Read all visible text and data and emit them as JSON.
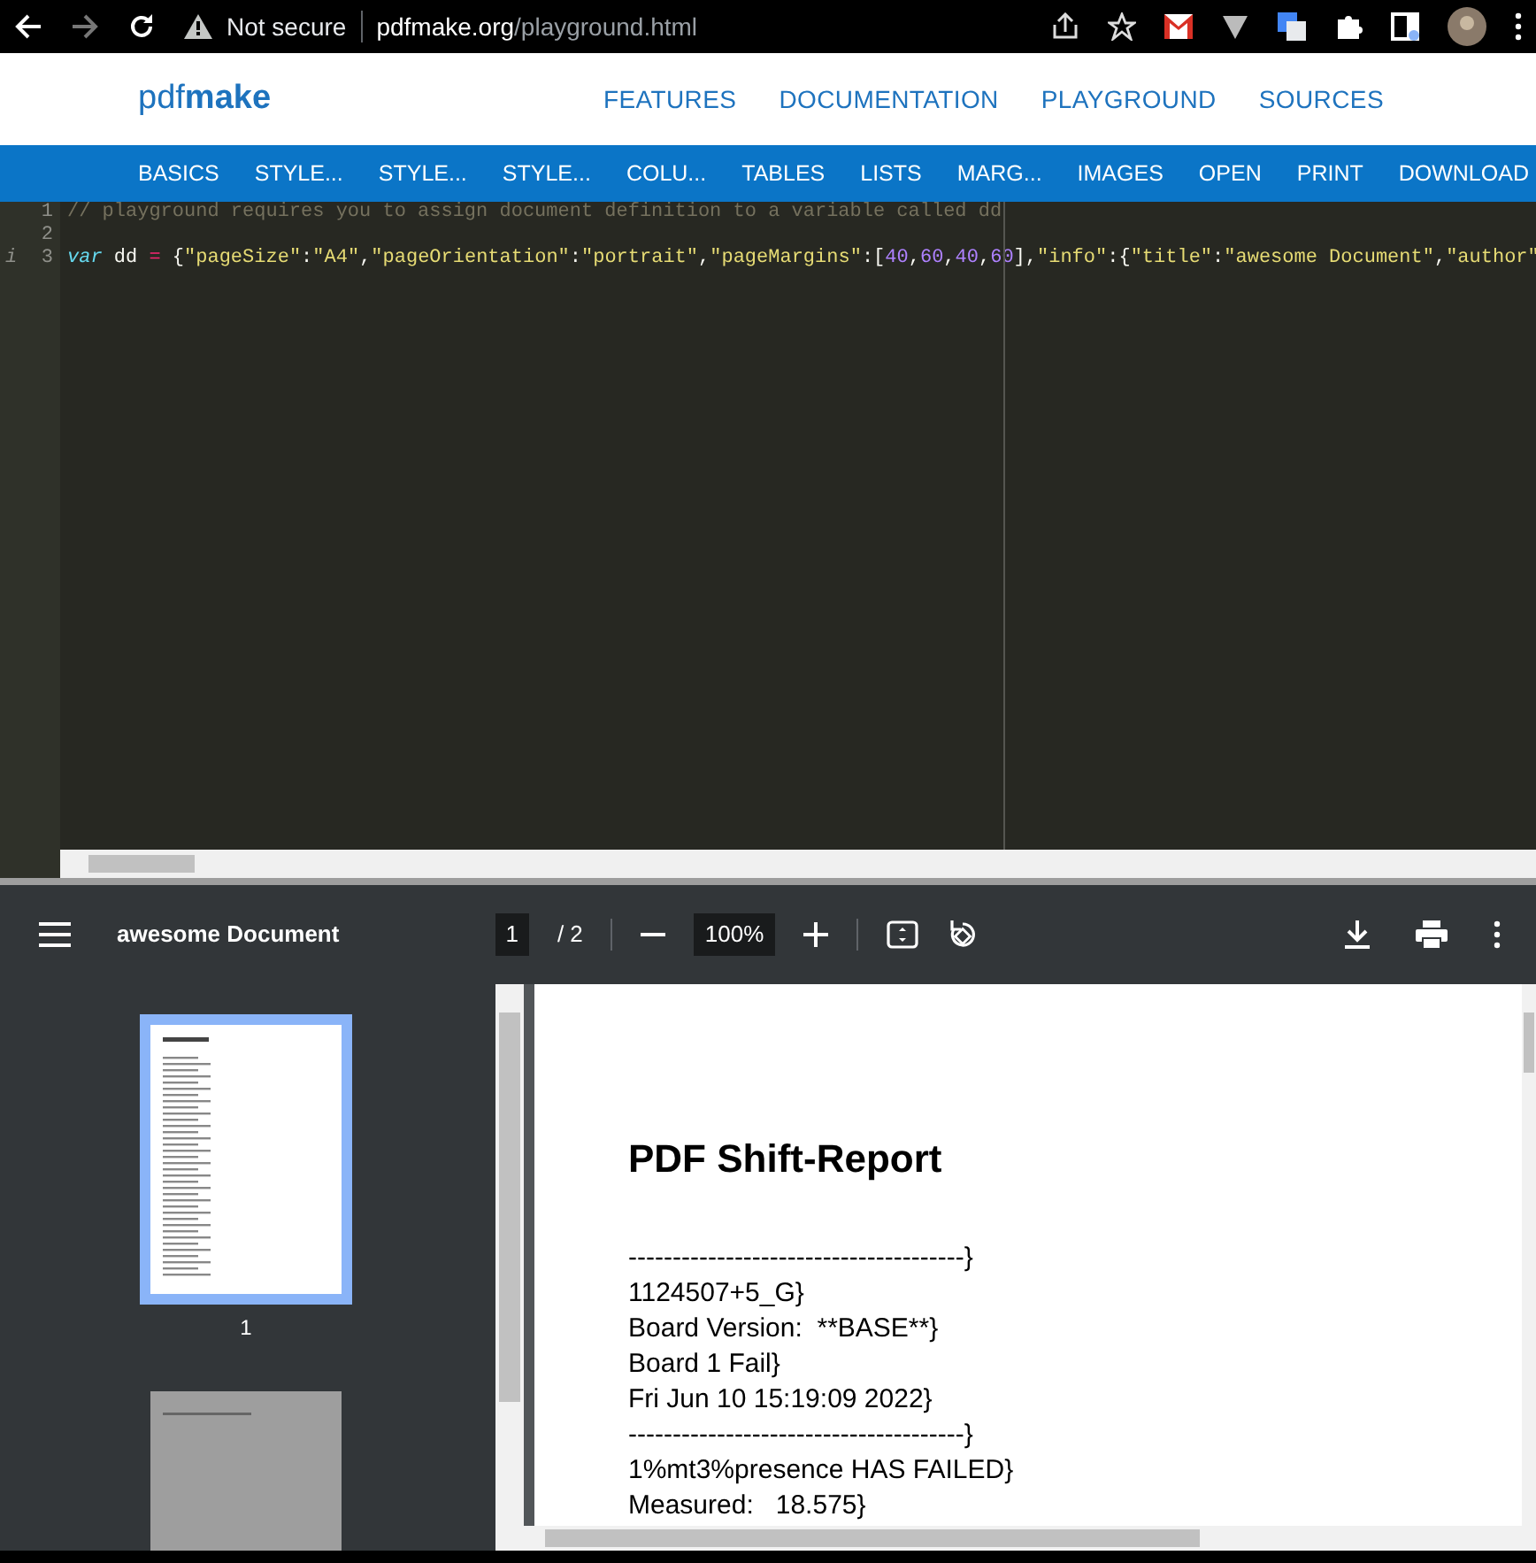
{
  "browser": {
    "security": "Not secure",
    "url_host": "pdfmake.org",
    "url_path": "/playground.html"
  },
  "site": {
    "brand": "pdf**make**",
    "nav": [
      "FEATURES",
      "DOCUMENTATION",
      "PLAYGROUND",
      "SOURCES"
    ]
  },
  "examples": [
    "BASICS",
    "STYLE...",
    "STYLE...",
    "STYLE...",
    "COLU...",
    "TABLES",
    "LISTS",
    "MARG...",
    "IMAGES",
    "OPEN",
    "PRINT",
    "DOWNLOAD"
  ],
  "editor": {
    "lines": [
      {
        "number": "1",
        "tokens": [
          {
            "kind": "comment",
            "text": "// playground requires you to assign document definition to a variable called dd"
          }
        ]
      },
      {
        "number": "2"
      },
      {
        "number": "3",
        "info": "i",
        "tokens": [
          {
            "kind": "keyword",
            "text": "var"
          },
          {
            "kind": "plain",
            "text": " dd "
          },
          {
            "kind": "operator",
            "text": "="
          },
          {
            "kind": "plain",
            "text": " {"
          },
          {
            "kind": "string",
            "text": "\"pageSize\""
          },
          {
            "kind": "plain",
            "text": ":"
          },
          {
            "kind": "string",
            "text": "\"A4\""
          },
          {
            "kind": "plain",
            "text": ","
          },
          {
            "kind": "string",
            "text": "\"pageOrientation\""
          },
          {
            "kind": "plain",
            "text": ":"
          },
          {
            "kind": "string",
            "text": "\"portrait\""
          },
          {
            "kind": "plain",
            "text": ","
          },
          {
            "kind": "string",
            "text": "\"pageMargins\""
          },
          {
            "kind": "plain",
            "text": ":["
          },
          {
            "kind": "number",
            "text": "40"
          },
          {
            "kind": "plain",
            "text": ","
          },
          {
            "kind": "number",
            "text": "60"
          },
          {
            "kind": "plain",
            "text": ","
          },
          {
            "kind": "number",
            "text": "40"
          },
          {
            "kind": "plain",
            "text": ","
          },
          {
            "kind": "number",
            "text": "60"
          },
          {
            "kind": "plain",
            "text": "],"
          },
          {
            "kind": "string",
            "text": "\"info\""
          },
          {
            "kind": "plain",
            "text": ":{"
          },
          {
            "kind": "string",
            "text": "\"title\""
          },
          {
            "kind": "plain",
            "text": ":"
          },
          {
            "kind": "string",
            "text": "\"awesome Document\""
          },
          {
            "kind": "plain",
            "text": ","
          },
          {
            "kind": "string",
            "text": "\"author\""
          }
        ]
      }
    ]
  },
  "pdf_viewer": {
    "title": "awesome Document",
    "page": "1",
    "page_total": "/ 2",
    "zoom": "100%",
    "thumbnails": [
      {
        "label": "1",
        "selected": true,
        "loaded": true
      },
      {
        "selected": false,
        "loaded": false
      }
    ],
    "document": {
      "heading": "PDF Shift-Report",
      "lines": [
        "--------------------------------------}",
        "1124507+5_G}",
        "Board Version:  **BASE**}",
        "Board 1 Fail}",
        "Fri Jun 10 15:19:09 2022}",
        "--------------------------------------}",
        "1%mt3%presence HAS FAILED}",
        "Measured:   18.575}"
      ]
    }
  }
}
